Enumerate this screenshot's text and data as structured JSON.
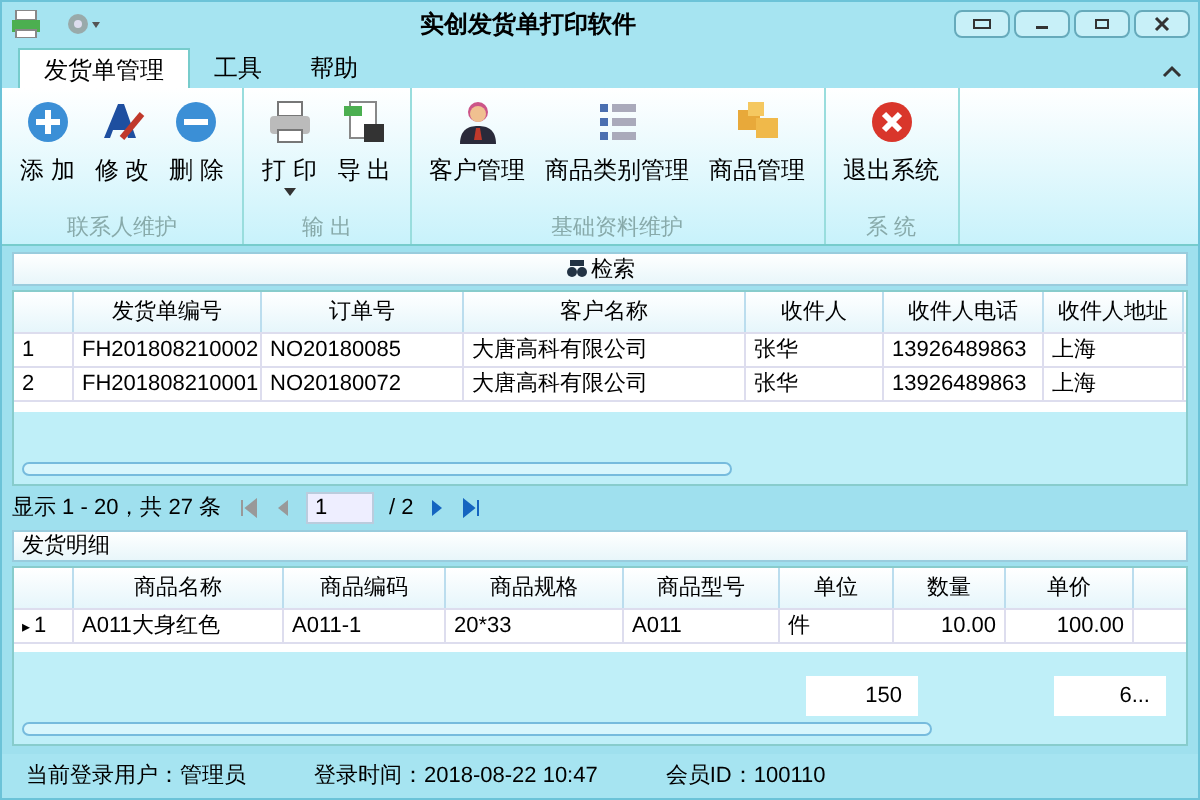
{
  "window": {
    "title": "实创发货单打印软件"
  },
  "tabs": [
    {
      "label": "发货单管理",
      "selected": true
    },
    {
      "label": "工具",
      "selected": false
    },
    {
      "label": "帮助",
      "selected": false
    }
  ],
  "ribbon_groups": [
    {
      "label": "联系人维护",
      "buttons": [
        {
          "label": "添 加",
          "dropdown": false
        },
        {
          "label": "修 改",
          "dropdown": false
        },
        {
          "label": "删 除",
          "dropdown": false
        }
      ]
    },
    {
      "label": "输 出",
      "buttons": [
        {
          "label": "打 印",
          "dropdown": true
        },
        {
          "label": "导 出",
          "dropdown": false
        }
      ]
    },
    {
      "label": "基础资料维护",
      "buttons": [
        {
          "label": "客户管理",
          "dropdown": false
        },
        {
          "label": "商品类别管理",
          "dropdown": false
        },
        {
          "label": "商品管理",
          "dropdown": false
        }
      ]
    },
    {
      "label": "系 统",
      "buttons": [
        {
          "label": "退出系统",
          "dropdown": false
        }
      ]
    }
  ],
  "search_bar": {
    "label": "检索"
  },
  "orders_table": {
    "columns": [
      "",
      "发货单编号",
      "订单号",
      "客户名称",
      "收件人",
      "收件人电话",
      "收件人地址"
    ],
    "rows": [
      {
        "cells": [
          "1",
          "FH201808210002",
          "NO20180085",
          "大唐高科有限公司",
          "张华",
          "13926489863",
          "上海"
        ]
      },
      {
        "cells": [
          "2",
          "FH201808210001",
          "NO20180072",
          "大唐高科有限公司",
          "张华",
          "13926489863",
          "上海"
        ]
      }
    ]
  },
  "pager": {
    "summary": "显示 1 - 20，共 27 条",
    "page": "1",
    "total": "/ 2"
  },
  "detail": {
    "title": "发货明细",
    "columns": [
      "",
      "商品名称",
      "商品编码",
      "商品规格",
      "商品型号",
      "单位",
      "数量",
      "单价"
    ],
    "rows": [
      {
        "marker": "▸",
        "cells": [
          "1",
          "A011大身红色",
          "A011-1",
          "20*33",
          "A011",
          "件",
          "10.00",
          "100.00"
        ]
      }
    ],
    "totals": [
      "150",
      "6..."
    ]
  },
  "status_bar": [
    "当前登录用户：管理员",
    "登录时间：2018-08-22 10:47",
    "会员ID：100110"
  ]
}
